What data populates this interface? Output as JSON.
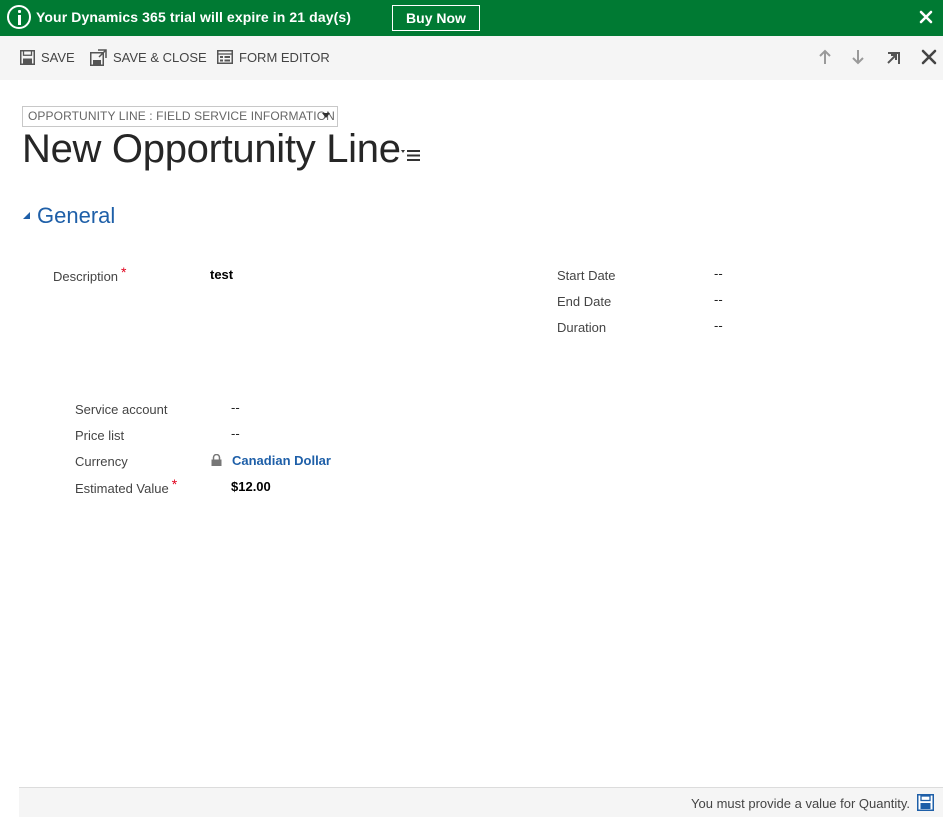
{
  "banner": {
    "message": "Your Dynamics 365 trial will expire in 21 day(s)",
    "buy_label": "Buy Now",
    "color": "#007a33"
  },
  "commands": {
    "save": "SAVE",
    "save_close": "SAVE & CLOSE",
    "form_editor": "FORM EDITOR"
  },
  "form": {
    "selector": "OPPORTUNITY LINE : FIELD SERVICE INFORMATION",
    "title": "New Opportunity Line"
  },
  "section": {
    "title": "General"
  },
  "fields": {
    "description": {
      "label": "Description",
      "required": "*",
      "value": "test"
    },
    "start_date": {
      "label": "Start Date",
      "value": "--"
    },
    "end_date": {
      "label": "End Date",
      "value": "--"
    },
    "duration": {
      "label": "Duration",
      "value": "--"
    },
    "service_account": {
      "label": "Service account",
      "value": "--"
    },
    "price_list": {
      "label": "Price list",
      "value": "--"
    },
    "currency": {
      "label": "Currency",
      "value": "Canadian Dollar"
    },
    "estimated_value": {
      "label": "Estimated Value",
      "required": "*",
      "value": "$12.00"
    }
  },
  "footer": {
    "message": "You must provide a value for Quantity."
  },
  "colors": {
    "accent": "#1e5fa8",
    "required": "#e0001b"
  }
}
